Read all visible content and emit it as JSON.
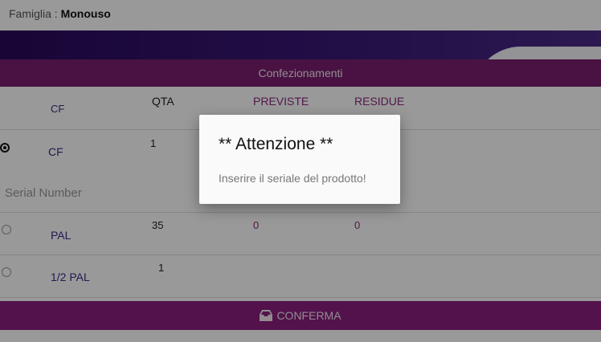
{
  "header": {
    "famiglia_label": "Famiglia :",
    "famiglia_value": "Monouso"
  },
  "section": {
    "title": "Confezionamenti"
  },
  "table": {
    "columns": {
      "cf": "CF",
      "qta": "QTA",
      "previste": "PREVISTE",
      "residue": "RESIDUE"
    },
    "rows": [
      {
        "label": "CF",
        "qta": "1",
        "previste": "",
        "residue": "",
        "selected": true
      },
      {
        "label": "PAL",
        "qta": "35",
        "previste": "0",
        "residue": "0",
        "selected": false
      },
      {
        "label": "1/2 PAL",
        "qta": "1",
        "previste": "",
        "residue": "",
        "selected": false
      }
    ]
  },
  "serial": {
    "placeholder": "Serial Number"
  },
  "footer": {
    "confirm_label": "CONFERMA",
    "confirm_icon": "inbox-icon"
  },
  "dialog": {
    "title": "** Attenzione **",
    "message": "Inserire il seriale del prodotto!"
  },
  "colors": {
    "banner": "#2a0a5a",
    "accent": "#8a1f7e",
    "label": "#3b2a8a"
  }
}
